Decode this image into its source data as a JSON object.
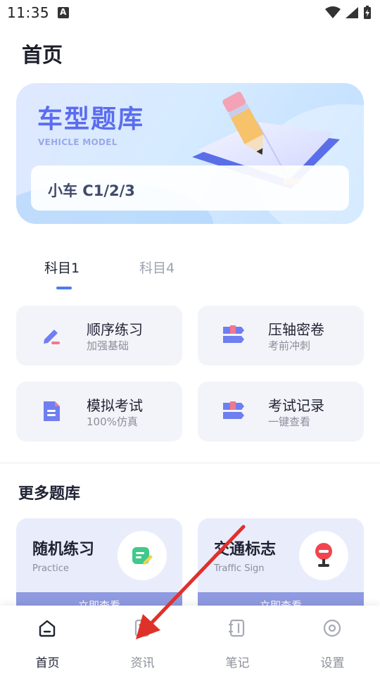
{
  "status": {
    "time": "11:35"
  },
  "page": {
    "title": "首页"
  },
  "banner": {
    "title": "车型题库",
    "subtitle": "VEHICLE MODEL",
    "vehicle": "小车 C1/2/3"
  },
  "tabs": [
    {
      "label": "科目1",
      "active": true
    },
    {
      "label": "科目4",
      "active": false
    }
  ],
  "practice": [
    {
      "title": "顺序练习",
      "subtitle": "加强基础",
      "icon": "pencil-icon"
    },
    {
      "title": "压轴密卷",
      "subtitle": "考前冲刺",
      "icon": "ribbon-icon"
    },
    {
      "title": "模拟考试",
      "subtitle": "100%仿真",
      "icon": "document-icon"
    },
    {
      "title": "考试记录",
      "subtitle": "一键查看",
      "icon": "ribbon-icon"
    }
  ],
  "more": {
    "title": "更多题库",
    "cards": [
      {
        "title": "随机练习",
        "subtitle": "Practice",
        "button": "立即查看",
        "icon": "note-icon"
      },
      {
        "title": "交通标志",
        "subtitle": "Traffic Sign",
        "button": "立即查看",
        "icon": "stop-sign-icon"
      }
    ]
  },
  "nav": [
    {
      "label": "首页",
      "icon": "home-icon",
      "active": true
    },
    {
      "label": "资讯",
      "icon": "news-icon",
      "active": false
    },
    {
      "label": "笔记",
      "icon": "notebook-icon",
      "active": false
    },
    {
      "label": "设置",
      "icon": "settings-icon",
      "active": false
    }
  ],
  "colors": {
    "accent": "#4c7cf0",
    "banner_title": "#5b6cf0",
    "tile_bg": "#f3f4f9",
    "more_bar": "#8f9ae0",
    "arrow": "#e0302a"
  }
}
